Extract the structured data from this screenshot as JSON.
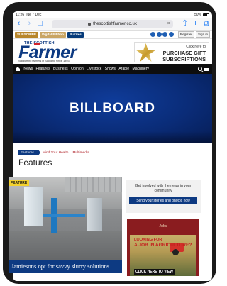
{
  "status": {
    "time": "11:26",
    "date": "Tue 7 Dec",
    "wifi_battery": "50%"
  },
  "browser": {
    "url": "thescottishfarmer.co.uk"
  },
  "topbar": {
    "subscribe": "SUBSCRIBE",
    "digital": "Digital Edition",
    "puzzles": "Puzzles",
    "register": "Register",
    "sign_in": "Sign in"
  },
  "masthead": {
    "logo_small": "THE SCOTTISH",
    "logo_big": "Farmer",
    "tagline": "Supporting farmers in Scotland since 1893",
    "ad_line1": "Click here to",
    "ad_line2": "PURCHASE GIFT",
    "ad_line3": "SUBSCRIPTIONS"
  },
  "nav": {
    "items": [
      "News",
      "Features",
      "Business",
      "Opinion",
      "Livestock",
      "Shows",
      "Arable",
      "Machinery"
    ]
  },
  "billboard": {
    "label": "BILLBOARD"
  },
  "breadcrumb": {
    "main": "Features",
    "item1": "Mind Your Health",
    "item2": "Multimedia"
  },
  "section": {
    "title": "Features"
  },
  "feature": {
    "label": "FEATURE",
    "caption": "Jamiesons opt for savvy slurry solutions"
  },
  "community": {
    "text": "Get involved with the news in your community",
    "button": "Send your stories and photos now"
  },
  "jobs": {
    "title": "Jobs",
    "ad_line1": "LOOKING FOR",
    "ad_line2": "A JOB IN AGRICULTURE?",
    "ad_line3": "CLICK HERE TO VIEW"
  },
  "colors": {
    "brand_blue": "#0d3a82",
    "nav_black": "#0e0e0e",
    "gold": "#b8862b",
    "jobs_red": "#8a1c1f"
  }
}
